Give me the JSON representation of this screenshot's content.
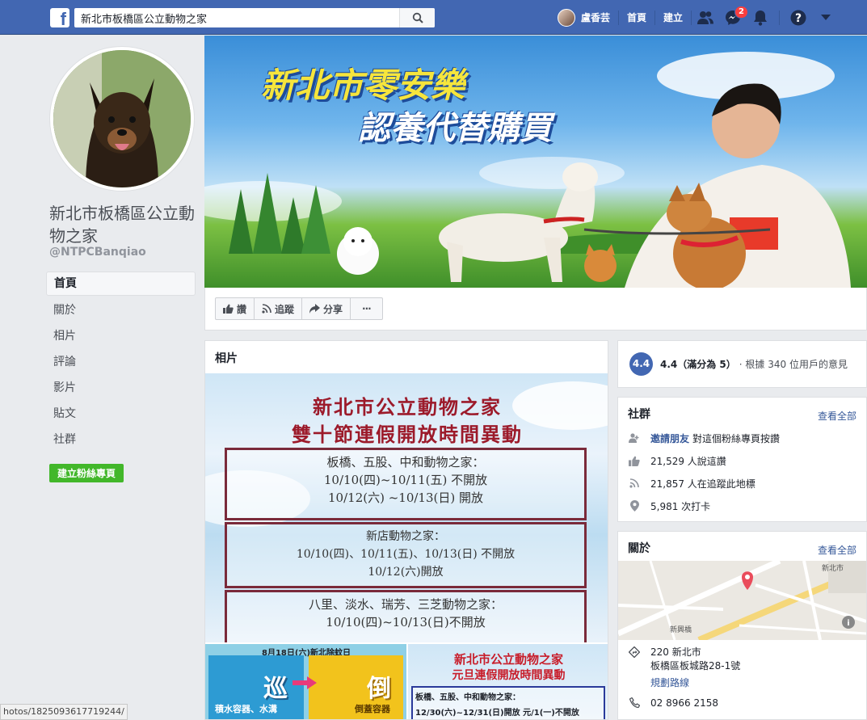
{
  "topbar": {
    "logo": "f",
    "search_value": "新北市板橋區公立動物之家",
    "user_name": "盧香芸",
    "home": "首頁",
    "create": "建立",
    "message_badge": "2"
  },
  "page": {
    "name": "新北市板橋區公立動物之家",
    "handle": "@NTPCBanqiao"
  },
  "left_nav": [
    {
      "label": "首頁"
    },
    {
      "label": "關於"
    },
    {
      "label": "相片"
    },
    {
      "label": "評論"
    },
    {
      "label": "影片"
    },
    {
      "label": "貼文"
    },
    {
      "label": "社群"
    }
  ],
  "create_page_button": "建立粉絲專頁",
  "cover": {
    "line1": "新北市零安樂",
    "line2": "認養代替購買"
  },
  "actions": {
    "like": "讚",
    "follow": "追蹤",
    "share": "分享",
    "more": "···"
  },
  "photos": {
    "title": "相片",
    "main": {
      "title1": "新北市公立動物之家",
      "title2": "雙十節連假開放時間異動",
      "box1": [
        "板橋、五股、中和動物之家：",
        "10/10(四)~10/11(五) 不開放",
        "10/12(六) ~10/13(日) 開放"
      ],
      "box2": [
        "新店動物之家：",
        "10/10(四)、10/11(五)、10/13(日) 不開放",
        "10/12(六)開放"
      ],
      "box3": [
        "八里、淡水、瑞芳、三芝動物之家：",
        "10/10(四)~10/13(日)不開放"
      ]
    },
    "small1": {
      "header": "8月18日(六)新北除蚊日",
      "word1": "巡",
      "word2": "倒",
      "cap1": "積水容器、水溝",
      "cap2": "倒蓋容器"
    },
    "small2": {
      "title1": "新北市公立動物之家",
      "title2": "元旦連假開放時間異動",
      "line1": "板橋、五股、中和動物之家：",
      "line2": "12/30(六)~12/31(日)開放 元/1(一)不開放"
    }
  },
  "rating": {
    "circle": "4.4",
    "score": "4.4（滿分為 5）",
    "text": "· 根據 340 位用戶的意見"
  },
  "community": {
    "title": "社群",
    "see_all": "查看全部",
    "invite_link": "邀請朋友",
    "invite_text": "對這個粉絲專頁按讚",
    "likes": "21,529 人說這讚",
    "follows": "21,857 人在追蹤此地標",
    "checkins": "5,981 次打卡"
  },
  "about": {
    "title": "關於",
    "see_all": "查看全部",
    "map_labels": [
      "新興橋",
      "新北市"
    ],
    "address_line1": "220 新北市",
    "address_line2": "板橋區板城路28-1號",
    "directions": "規劃路線",
    "phone": "02 8966 2158"
  },
  "status_url": "hotos/1825093617719244/",
  "colors": {
    "brand": "#4267b2",
    "create_green": "#42b72a",
    "link": "#365899"
  }
}
